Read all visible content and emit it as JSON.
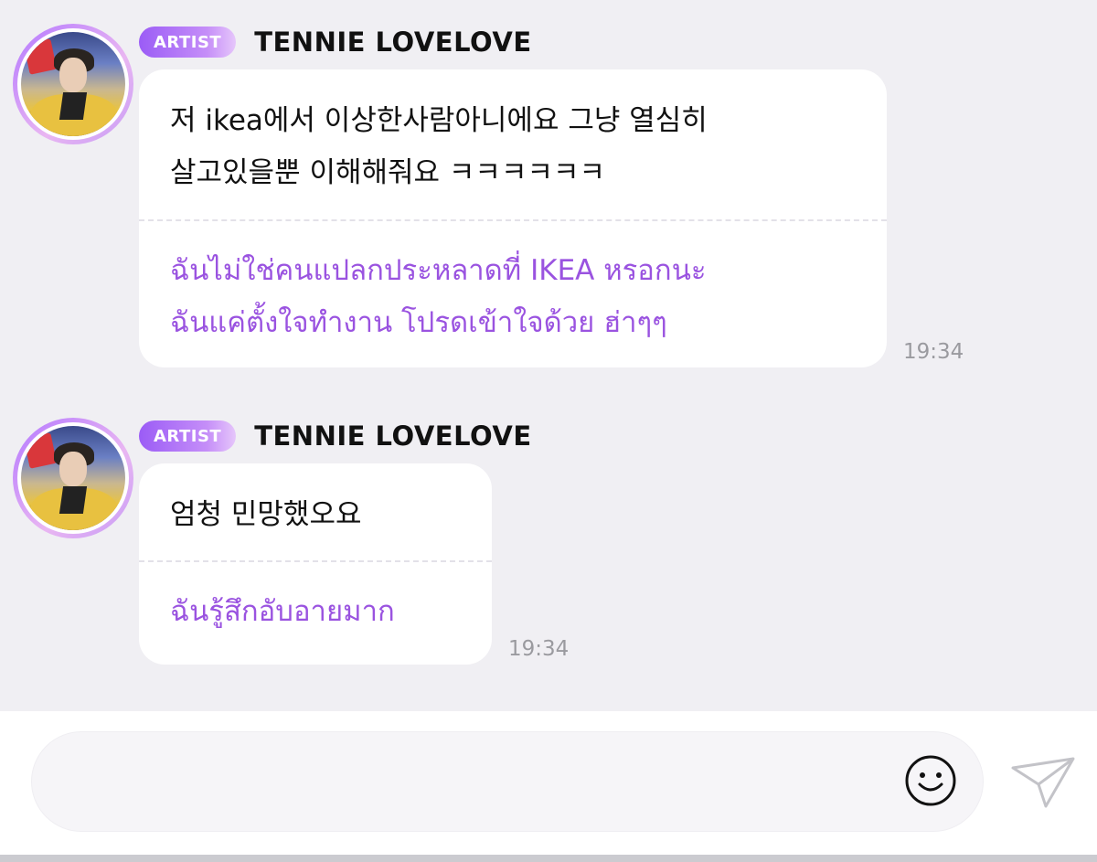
{
  "messages": [
    {
      "badge": "ARTIST",
      "sender": "TENNIE LOVELOVE",
      "original_lines": [
        "저 ikea에서 이상한사람아니에요 그냥 열심히",
        "살고있을뿐 이해해줘요 ㅋㅋㅋㅋㅋㅋ"
      ],
      "translation_lines": [
        "ฉันไม่ใช่คนแปลกประหลาดที่ IKEA หรอกนะ",
        "ฉันแค่ตั้งใจทำงาน โปรดเข้าใจด้วย ฮ่าๆๆ"
      ],
      "time": "19:34"
    },
    {
      "badge": "ARTIST",
      "sender": "TENNIE LOVELOVE",
      "original_lines": [
        "엄청 민망했오요"
      ],
      "translation_lines": [
        "ฉันรู้สึกอับอายมาก"
      ],
      "time": "19:34"
    }
  ],
  "input": {
    "placeholder": ""
  },
  "icons": {
    "emoji": "smiley-face-icon",
    "send": "paper-plane-icon"
  },
  "colors": {
    "accent": "#9b5cf6",
    "translation_text": "#9a53e0",
    "background": "#f0eff3"
  }
}
